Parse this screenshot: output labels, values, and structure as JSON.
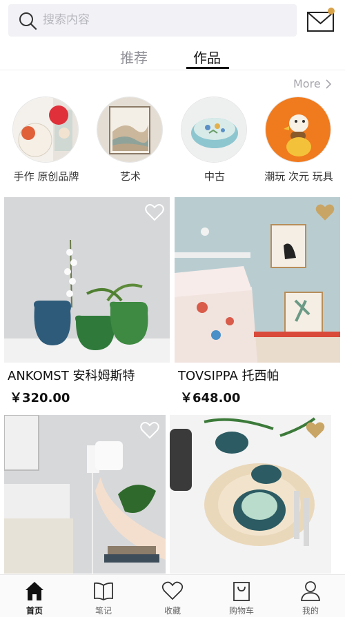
{
  "search": {
    "placeholder": "搜索内容"
  },
  "tabs": [
    {
      "label": "推荐",
      "active": false
    },
    {
      "label": "作品",
      "active": true
    }
  ],
  "more_label": "More",
  "categories": [
    {
      "label": "手作 原创品牌",
      "icon": "paper-fan-image"
    },
    {
      "label": "艺术",
      "icon": "landscape-painting-image"
    },
    {
      "label": "中古",
      "icon": "floral-bowl-image"
    },
    {
      "label": "潮玩 次元 玩具",
      "icon": "duck-toy-image"
    }
  ],
  "products": [
    {
      "name": "ANKOMST 安科姆斯特",
      "price": "￥320.00",
      "favorited": false
    },
    {
      "name": "TOVSIPPA 托西帕",
      "price": "￥648.00",
      "favorited": true
    },
    {
      "name": "",
      "price": "",
      "favorited": false
    },
    {
      "name": "",
      "price": "",
      "favorited": true
    }
  ],
  "nav": [
    {
      "label": "首页",
      "icon": "home-icon",
      "active": true
    },
    {
      "label": "笔记",
      "icon": "book-icon",
      "active": false
    },
    {
      "label": "收藏",
      "icon": "heart-icon",
      "active": false
    },
    {
      "label": "购物车",
      "icon": "shopping-bag-icon",
      "active": false
    },
    {
      "label": "我的",
      "icon": "user-icon",
      "active": false
    }
  ],
  "colors": {
    "favorite_heart": "#c9a565",
    "accent": "#111111",
    "muted": "#8f8f97"
  }
}
